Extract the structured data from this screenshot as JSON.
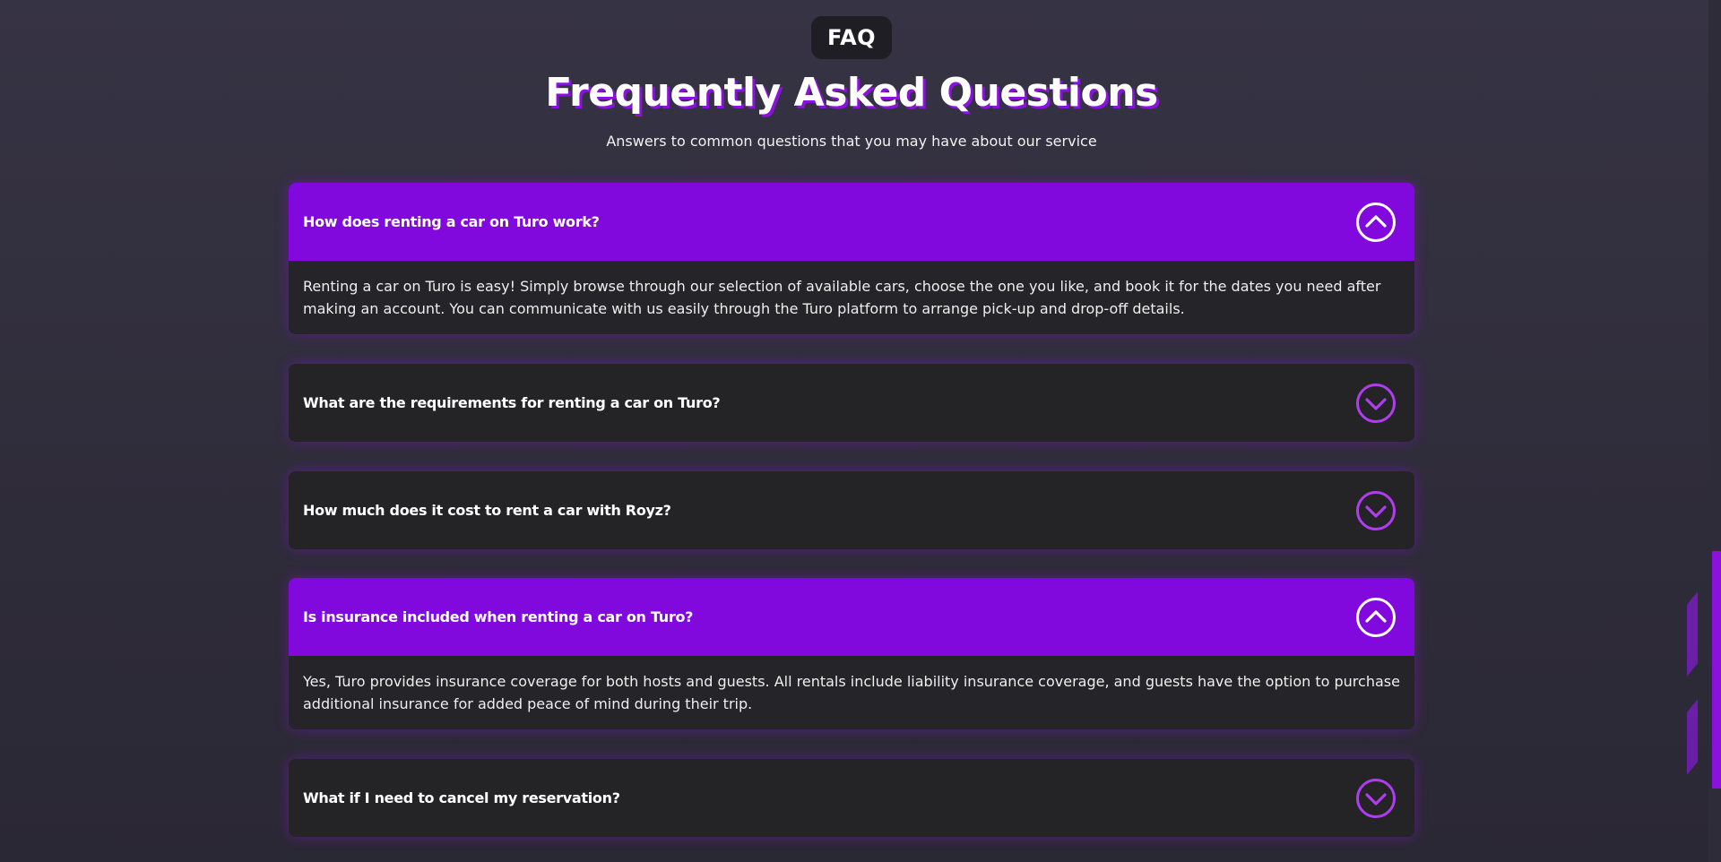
{
  "header": {
    "badge": "FAQ",
    "title": "Frequently Asked Questions",
    "subtitle": "Answers to common questions that you may have about our service"
  },
  "colors": {
    "accent": "#8109dd",
    "card": "#242326",
    "background": "#363344",
    "toggle_open": "#ffffff",
    "toggle_closed": "#b13bef"
  },
  "faqs": [
    {
      "question": "How does renting a car on Turo work?",
      "answer": "Renting a car on Turo is easy! Simply browse through our selection of available cars, choose the one you like, and book it for the dates you need after making an account. You can communicate with us easily through the Turo platform to arrange pick-up and drop-off details.",
      "expanded": true,
      "icon": "chevron-up-circle-icon"
    },
    {
      "question": "What are the requirements for renting a car on Turo?",
      "answer": "",
      "expanded": false,
      "icon": "chevron-down-circle-icon"
    },
    {
      "question": "How much does it cost to rent a car with Royz?",
      "answer": "",
      "expanded": false,
      "icon": "chevron-down-circle-icon"
    },
    {
      "question": "Is insurance included when renting a car on Turo?",
      "answer": "Yes, Turo provides insurance coverage for both hosts and guests. All rentals include liability insurance coverage, and guests have the option to purchase additional insurance for added peace of mind during their trip.",
      "expanded": true,
      "icon": "chevron-up-circle-icon"
    },
    {
      "question": "What if I need to cancel my reservation?",
      "answer": "",
      "expanded": false,
      "icon": "chevron-down-circle-icon"
    }
  ]
}
